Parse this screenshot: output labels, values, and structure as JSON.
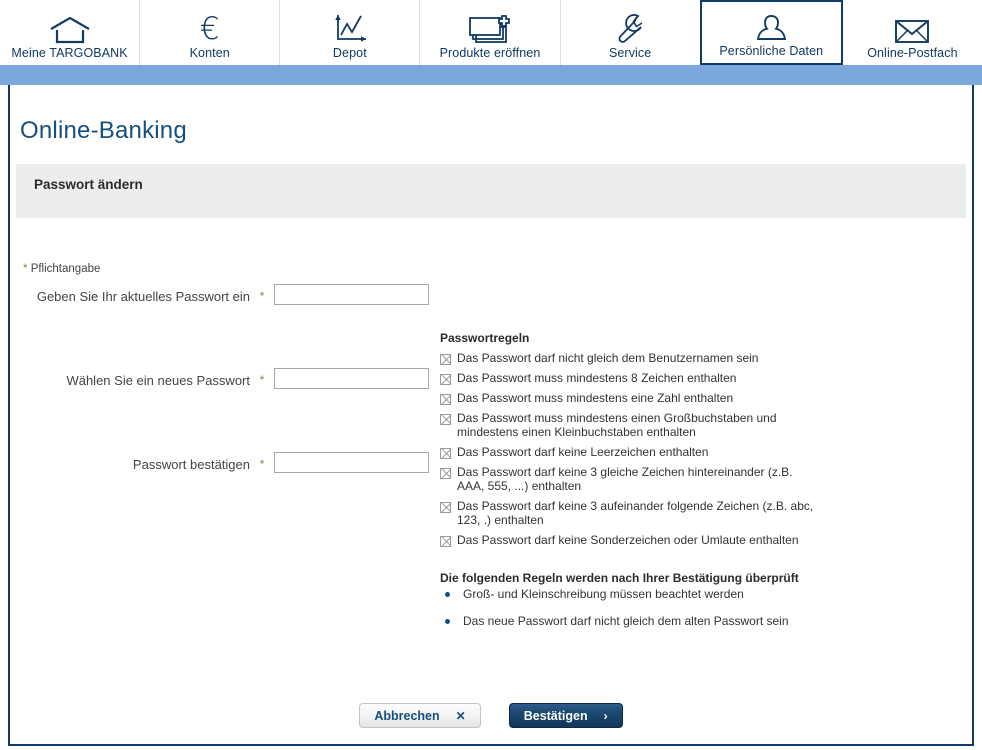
{
  "nav": {
    "items": [
      {
        "label": "Meine TARGOBANK",
        "icon": "house-icon",
        "active": false
      },
      {
        "label": "Konten",
        "icon": "euro-icon",
        "active": false
      },
      {
        "label": "Depot",
        "icon": "chart-icon",
        "active": false
      },
      {
        "label": "Produkte eröffnen",
        "icon": "new-product-icon",
        "active": false
      },
      {
        "label": "Service",
        "icon": "wrench-icon",
        "active": false
      },
      {
        "label": "Persönliche Daten",
        "icon": "person-icon",
        "active": true
      },
      {
        "label": "Online-Postfach",
        "icon": "envelope-icon",
        "active": false
      }
    ]
  },
  "page": {
    "title": "Online-Banking",
    "section_title": "Passwort ändern",
    "mandatory_star": "*",
    "mandatory_note": "Pflichtangabe"
  },
  "form": {
    "fields": [
      {
        "label": "Geben Sie Ihr aktuelles Passwort ein",
        "star": "*",
        "value": "",
        "placeholder": ""
      },
      {
        "label": "Wählen Sie ein neues Passwort",
        "star": "*",
        "value": "",
        "placeholder": ""
      },
      {
        "label": "Passwort bestätigen",
        "star": "*",
        "value": "",
        "placeholder": ""
      }
    ]
  },
  "rules": {
    "heading": "Passwortregeln",
    "items": [
      "Das Passwort darf nicht gleich dem Benutzernamen sein",
      "Das Passwort muss mindestens 8 Zeichen enthalten",
      "Das Passwort muss mindestens eine Zahl enthalten",
      "Das Passwort muss mindestens einen Großbuchstaben und mindestens einen Kleinbuchstaben enthalten",
      "Das Passwort darf keine Leerzeichen enthalten",
      "Das Passwort darf keine 3 gleiche Zeichen hintereinander (z.B. AAA, 555, ...) enthalten",
      "Das Passwort darf keine 3 aufeinander folgende Zeichen (z.B. abc, 123, .) enthalten",
      "Das Passwort darf keine Sonderzeichen oder Umlaute enthalten"
    ],
    "heading2": "Die folgenden Regeln werden nach Ihrer Bestätigung überprüft",
    "items2": [
      "Groß- und Kleinschreibung müssen beachtet werden",
      "Das neue Passwort darf nicht gleich dem alten Passwort sein"
    ]
  },
  "buttons": {
    "cancel_label": "Abbrechen",
    "cancel_glyph": "✕",
    "confirm_label": "Bestätigen",
    "confirm_glyph": "›"
  },
  "colors": {
    "brand_navy": "#0d3a68",
    "brand_blue": "#16507f",
    "band_blue": "#7ba7dc",
    "section_gray": "#eceded",
    "star_olive": "#7d8a4b"
  }
}
